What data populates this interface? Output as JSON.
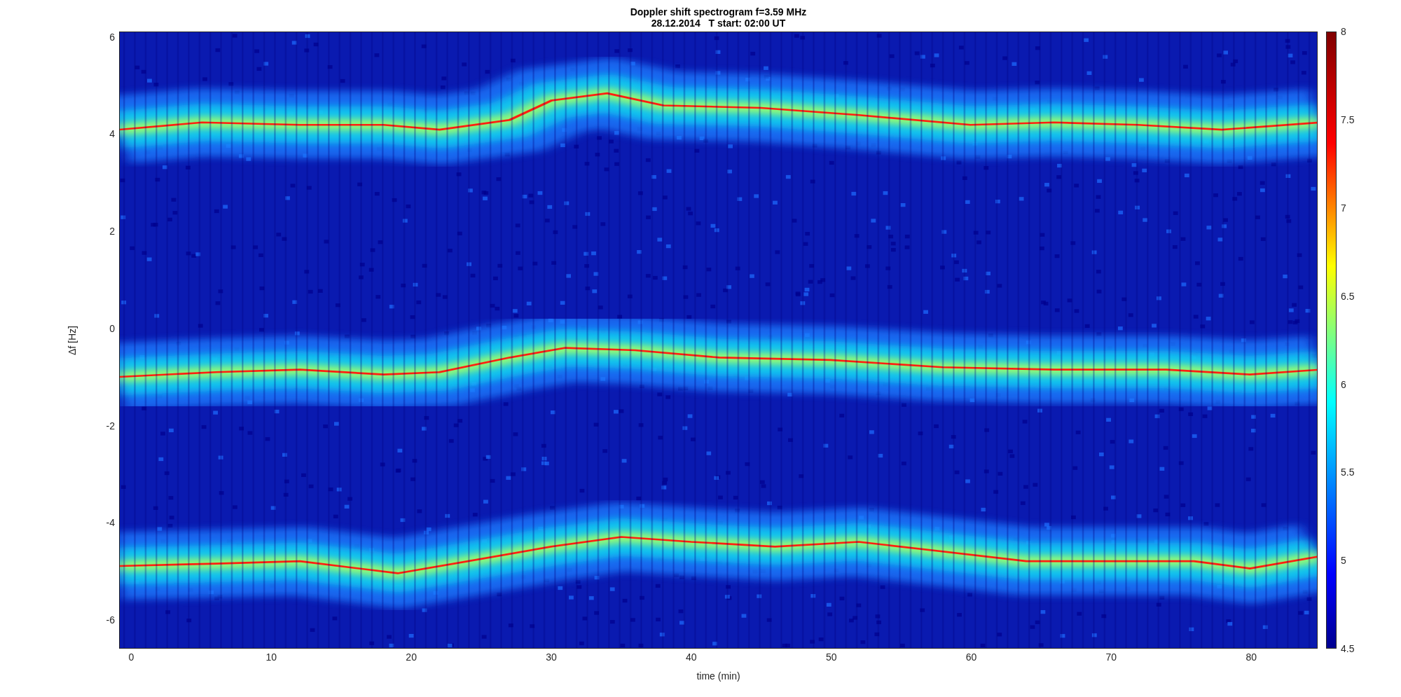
{
  "figure": {
    "title": [
      "Doppler shift spectrogram f=3.59 MHz",
      "28.12.2014   T start: 02:00 UT"
    ],
    "xlabel": "time (min)",
    "ylabel": "Δf [Hz]",
    "xticks": [
      "0",
      "10",
      "20",
      "30",
      "40",
      "50",
      "60",
      "70",
      "80"
    ],
    "yticks": [
      "6",
      "4",
      "2",
      "0",
      "-2",
      "-4",
      "-6"
    ],
    "colorbar_ticks": [
      "8",
      "7.5",
      "7",
      "6.5",
      "6",
      "5.5",
      "5",
      "4.5"
    ]
  }
}
